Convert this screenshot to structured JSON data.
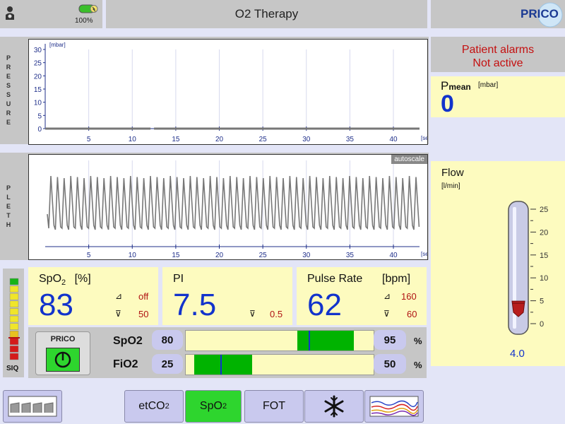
{
  "header": {
    "battery_percent": "100%",
    "title": "O2 Therapy",
    "logo": "PRICO"
  },
  "alarms": {
    "line1": "Patient alarms",
    "line2": "Not active"
  },
  "pmean": {
    "label": "P",
    "label_sub": "mean",
    "unit": "[mbar]",
    "value": "0"
  },
  "flow": {
    "label": "Flow",
    "unit": "[l/min]",
    "value": "4.0",
    "level_lpm": 4.0,
    "scale": [
      "25",
      "20",
      "15",
      "10",
      "5",
      "0"
    ]
  },
  "pressure_graph": {
    "side_label": [
      "P",
      "R",
      "E",
      "S",
      "S",
      "U",
      "R",
      "E"
    ],
    "unit_y": "[mbar]",
    "unit_x": "[sec]",
    "y_ticks": [
      "30",
      "25",
      "20",
      "15",
      "10",
      "5",
      "0"
    ],
    "x_ticks": [
      "5",
      "10",
      "15",
      "20",
      "25",
      "30",
      "35",
      "40"
    ]
  },
  "pleth_graph": {
    "side_label": [
      "P",
      "L",
      "E",
      "T",
      "H"
    ],
    "autoscale": "autoscale",
    "unit_x": "[sec]",
    "x_ticks": [
      "5",
      "10",
      "15",
      "20",
      "25",
      "30",
      "35",
      "40"
    ]
  },
  "siq": {
    "label": "SIQ"
  },
  "spo2_card": {
    "title": "SpO",
    "title_sub": "2",
    "unit": "[%]",
    "value": "83",
    "high_alarm": "off",
    "low_alarm": "50"
  },
  "pi_card": {
    "title": "PI",
    "value": "7.5",
    "low_alarm": "0.5"
  },
  "pulse_card": {
    "title": "Pulse Rate",
    "unit": "[bpm]",
    "value": "62",
    "high_alarm": "160",
    "low_alarm": "60"
  },
  "controller": {
    "brand": "PRICO",
    "rows": [
      {
        "label": "SpO2",
        "low": "80",
        "high": "95",
        "unit": "%"
      },
      {
        "label": "FiO2",
        "low": "25",
        "high": "50",
        "unit": "%"
      }
    ]
  },
  "tabs": {
    "etco2": {
      "label": "etCO",
      "sub": "2"
    },
    "spo2": {
      "label": "SpO",
      "sub": "2"
    },
    "fot": {
      "label": "FOT"
    }
  },
  "colors": {
    "accent_blue": "#1233cc",
    "alarm_red": "#b01313",
    "panel_yellow": "#fdfbbf",
    "active_green": "#2ed52e"
  }
}
